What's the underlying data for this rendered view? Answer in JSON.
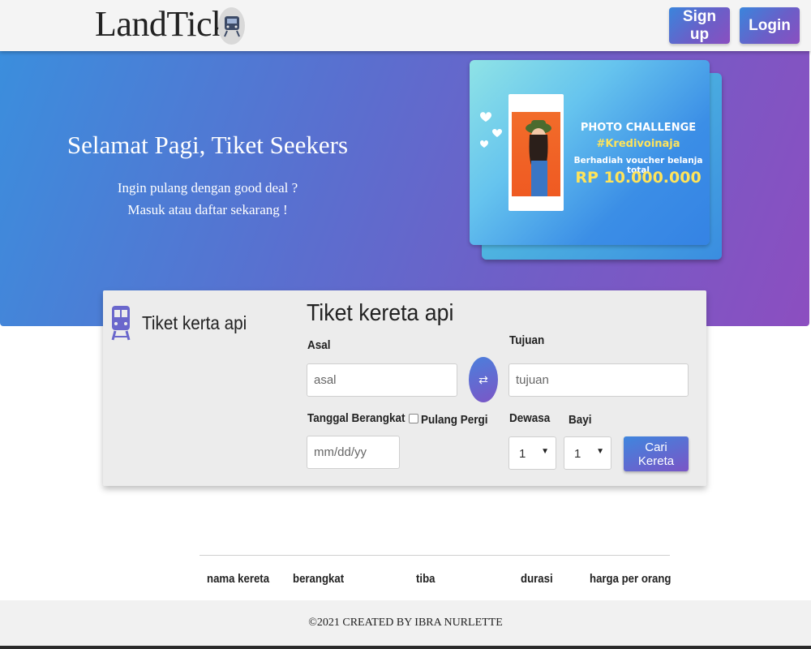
{
  "navbar": {
    "brand": "LandTick",
    "signup_label": "Sign up",
    "login_label": "Login"
  },
  "hero": {
    "greeting": "Selamat Pagi, Tiket Seekers",
    "line1": "Ingin pulang dengan good deal ?",
    "line2": "Masuk atau daftar sekarang !",
    "banner": {
      "line1": "PHOTO CHALLENGE",
      "line2": "#Kredivoinaja",
      "line3": "Berhadiah voucher belanja total",
      "line4": "RP 10.000.000"
    }
  },
  "ticket_form": {
    "side_title": "Tiket kerta api",
    "title": "Tiket kereta api",
    "asal_label": "Asal",
    "asal_placeholder": "asal",
    "tujuan_label": "Tujuan",
    "tujuan_placeholder": "tujuan",
    "tanggal_label": "Tanggal Berangkat",
    "tanggal_placeholder": "mm/dd/yy",
    "pulang_pergi_label": "Pulang Pergi",
    "pulang_pergi_checked": false,
    "dewasa_label": "Dewasa",
    "dewasa_value": "1",
    "bayi_label": "Bayi",
    "bayi_value": "1",
    "search_label": "Cari Kereta",
    "swap_icon": "swap-arrows-icon",
    "train_icon": "train-icon"
  },
  "results": {
    "columns": [
      "nama kereta",
      "berangkat",
      "tiba",
      "durasi",
      "harga per orang"
    ]
  },
  "footer": {
    "text": "©2021 CREATED BY IBRA NURLETTE"
  },
  "colors": {
    "gradient_start": "#3b8edd",
    "gradient_end": "#8c4ec0"
  }
}
